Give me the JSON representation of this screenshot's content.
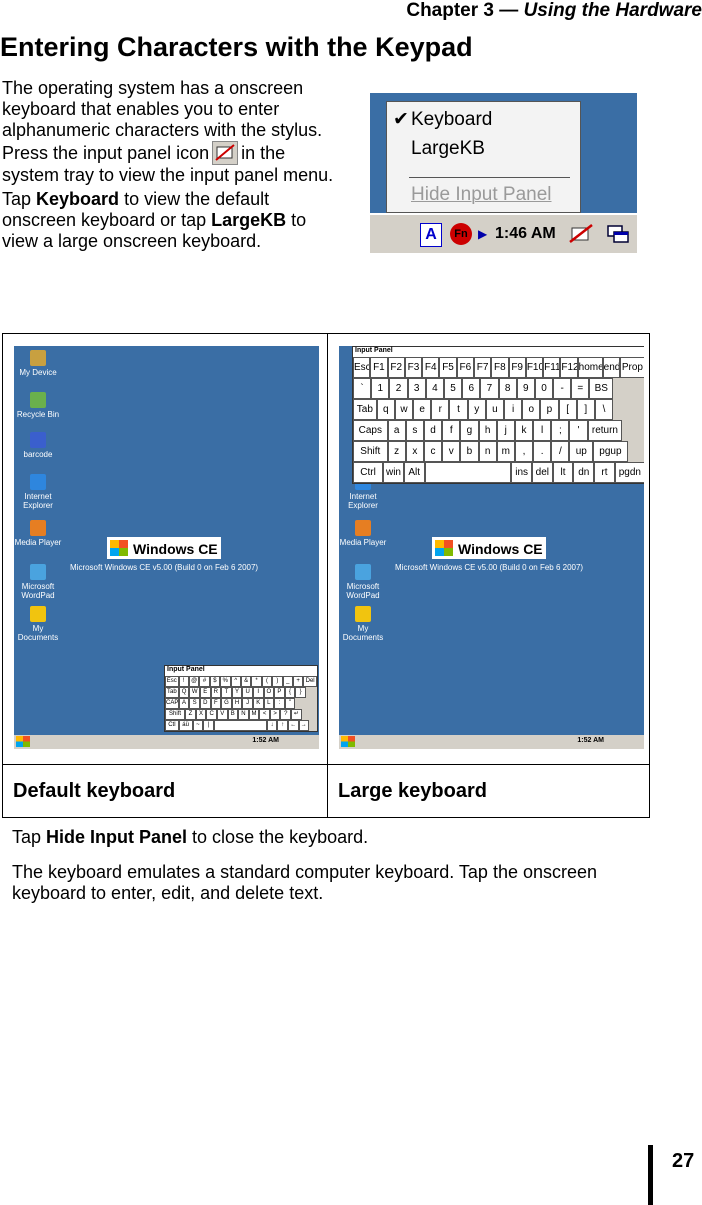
{
  "header": {
    "chapter": "Chapter 3 — ",
    "chapter_title": "Using the Hardware"
  },
  "title": "Entering Characters with the Keypad",
  "intro": {
    "p1_a": "The operating system has a onscreen keyboard that enables you to enter alphanumeric characters with the stylus. Press the input panel icon",
    "p1_b": "in the system tray to view the input panel menu.",
    "p2_a": "Tap ",
    "p2_keyboard": "Keyboard",
    "p2_b": " to view the default onscreen keyboard or tap ",
    "p2_largekb": "LargeKB",
    "p2_c": " to view a large onscreen keyboard."
  },
  "popup": {
    "items": [
      "Keyboard",
      "LargeKB",
      "Hide Input Panel"
    ],
    "time": "1:46 AM"
  },
  "figures": {
    "default_caption": "Default keyboard",
    "large_caption": "Large keyboard",
    "desktop_icons": [
      "My Device",
      "Recycle Bin",
      "barcode",
      "Internet Explorer",
      "Media Player",
      "Microsoft WordPad",
      "My Documents"
    ],
    "logo_text": "Windows CE",
    "version_text": "Microsoft Windows CE v5.00 (Build 0 on Feb  6 2007)",
    "input_panel_title": "Input Panel",
    "screen_time": "1:52 AM",
    "large_rows": [
      [
        "Esc",
        "F1",
        "F2",
        "F3",
        "F4",
        "F5",
        "F6",
        "F7",
        "F8",
        "F9",
        "F10",
        "F11",
        "F12",
        "home",
        "end",
        "Prop"
      ],
      [
        "`",
        "1",
        "2",
        "3",
        "4",
        "5",
        "6",
        "7",
        "8",
        "9",
        "0",
        "-",
        "=",
        "BS"
      ],
      [
        "Tab",
        "q",
        "w",
        "e",
        "r",
        "t",
        "y",
        "u",
        "i",
        "o",
        "p",
        "[",
        "]",
        "\\"
      ],
      [
        "Caps Lock",
        "a",
        "s",
        "d",
        "f",
        "g",
        "h",
        "j",
        "k",
        "l",
        ";",
        "'",
        "return"
      ],
      [
        "Shift",
        "z",
        "x",
        "c",
        "v",
        "b",
        "n",
        "m",
        ",",
        ".",
        "/",
        "up",
        "pgup"
      ],
      [
        "Ctrl",
        "win",
        "Alt",
        "",
        "ins",
        "del",
        "lt",
        "dn",
        "rt",
        "pgdn"
      ]
    ],
    "default_rows": [
      [
        "Esc",
        "!",
        "@",
        "#",
        "$",
        "%",
        "^",
        "&",
        "*",
        "(",
        ")",
        "_",
        "+",
        "Del"
      ],
      [
        "Tab",
        "Q",
        "W",
        "E",
        "R",
        "T",
        "Y",
        "U",
        "I",
        "O",
        "P",
        "{",
        "}"
      ],
      [
        "CAP",
        "A",
        "S",
        "D",
        "F",
        "G",
        "H",
        "J",
        "K",
        "L",
        ":",
        "\""
      ],
      [
        "Shift",
        "Z",
        "X",
        "C",
        "V",
        "B",
        "N",
        "M",
        "<",
        ">",
        "?",
        "↵"
      ],
      [
        "Ctl",
        "áü",
        "~",
        "|",
        "",
        "↓",
        "↑",
        "←",
        "→"
      ]
    ]
  },
  "para2": {
    "p1_a": "Tap ",
    "p1_bold": "Hide Input Panel",
    "p1_b": " to close the keyboard.",
    "p2": "The keyboard emulates a standard computer keyboard. Tap the onscreen keyboard to enter, edit, and delete text."
  },
  "page_number": "27",
  "colors": {
    "desktop_blue": "#3a6ea5",
    "taskbar_gray": "#d4d0c8"
  }
}
